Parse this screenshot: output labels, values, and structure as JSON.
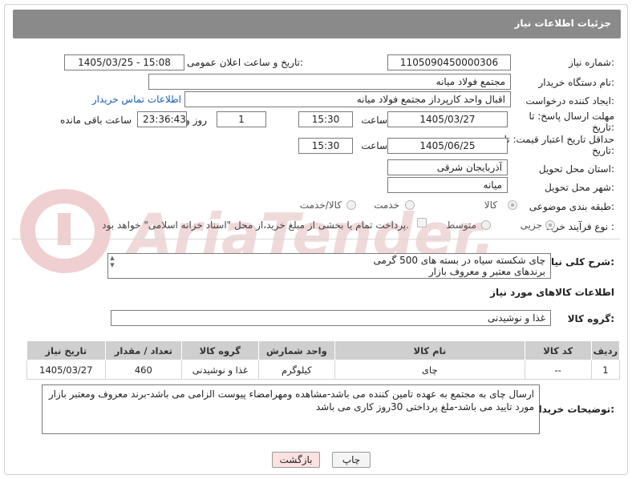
{
  "header": {
    "title": "جزئیات اطلاعات نیاز"
  },
  "labels": {
    "need_number": "شماره نیاز:",
    "announce_datetime": "تاریخ و ساعت اعلان عمومی:",
    "buyer_org": "نام دستگاه خریدار:",
    "requester": "ایجاد کننده درخواست:",
    "reply_deadline": "مهلت ارسال پاسخ: تا تاریخ:",
    "price_validity": "حداقل تاریخ اعتبار قیمت: تا تاریخ:",
    "delivery_province": "استان محل تحویل:",
    "delivery_city": "شهر محل تحویل:",
    "category": "طبقه بندی موضوعی:",
    "purchase_type": "نوع فرآیند خرید :",
    "time_word": "ساعت",
    "day_and": "روز و",
    "remaining": "ساعت باقی مانده",
    "need_description": "شرح کلی نیاز:",
    "goods_info": "اطلاعات کالاهای مورد نیاز",
    "goods_group": "گروه کالا:",
    "buyer_notes": "توضیحات خریدار:"
  },
  "fields": {
    "need_number": "1105090450000306",
    "announce_datetime": "1405/03/25 - 15:08",
    "buyer_org": "مجتمع فولاد میانه",
    "requester": "اقبال واحد کارپرداز مجتمع فولاد میانه",
    "contact_link": "اطلاعات تماس خریدار",
    "reply_date": "1405/03/27",
    "reply_time": "15:30",
    "reply_days": "1",
    "reply_remaining": "23:36:43",
    "validity_date": "1405/06/25",
    "validity_time": "15:30",
    "province": "آذربایجان شرقی",
    "city": "میانه",
    "need_description_line1": "چای شکسته سیاه در بسته های 500 گرمی",
    "need_description_line2": "برندهای معتبر و معروف بازار",
    "goods_group": "غذا و نوشیدنی",
    "buyer_notes": "ارسال چای به مجتمع به عهده تامین کننده می باشد-مشاهده ومهرامضاء پیوست الزامی می باشد-برند معروف ومعتبر بازار مورد تایید می باشد-ملغ پرداختی 30روز کاری می باشد"
  },
  "category_options": [
    {
      "label": "کالا",
      "selected": true
    },
    {
      "label": "خدمت",
      "selected": false
    },
    {
      "label": "کالا/خدمت",
      "selected": false
    }
  ],
  "purchase_options": [
    {
      "label": "جزیی",
      "selected": true
    },
    {
      "label": "متوسط",
      "selected": false
    }
  ],
  "payment_checkbox_label": "پرداخت تمام یا بخشی از مبلغ خرید،از محل \"اسناد خزانه اسلامی\" خواهد بود.",
  "table": {
    "headers": [
      "ردیف",
      "کد کالا",
      "نام کالا",
      "واحد شمارش",
      "گروه کالا",
      "تعداد / مقدار",
      "تاریخ نیاز"
    ],
    "rows": [
      [
        "1",
        "--",
        "چای",
        "کیلوگرم",
        "غذا و نوشیدنی",
        "460",
        "1405/03/27"
      ]
    ]
  },
  "buttons": {
    "print": "چاپ",
    "back": "بازگشت"
  },
  "watermark": {
    "text": "AriaTender.net"
  },
  "colors": {
    "header_bg": "#8a8a8a",
    "link": "#1a5fb4",
    "back_button_bg": "#fde2e2"
  }
}
